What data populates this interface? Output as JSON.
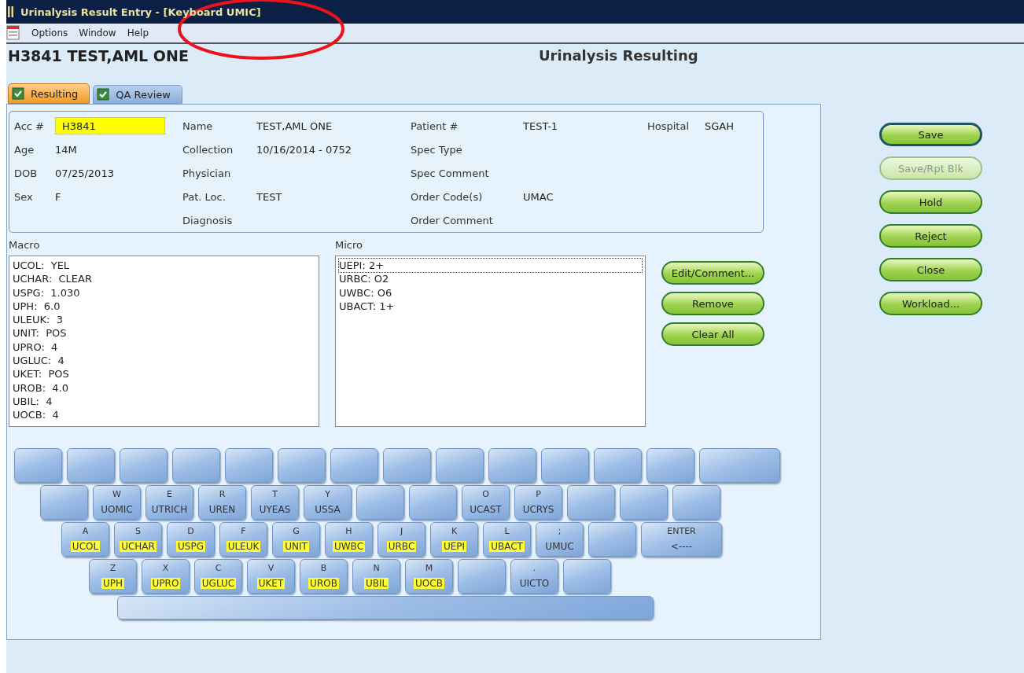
{
  "window": {
    "title": "Urinalysis Result Entry - [Keyboard UMIC]"
  },
  "menu": [
    "Options",
    "Window",
    "Help"
  ],
  "header": {
    "patient": "H3841 TEST,AML ONE",
    "screen_title": "Urinalysis Resulting"
  },
  "tabs": [
    {
      "label": "Resulting",
      "selected": true
    },
    {
      "label": "QA Review",
      "selected": false
    }
  ],
  "info": {
    "rows": [
      [
        {
          "label": "Acc #",
          "value": "H3841",
          "kind": "field"
        },
        {
          "label": "Name",
          "value": "TEST,AML ONE"
        },
        {
          "label": "Patient #",
          "value": "TEST-1"
        },
        {
          "label": "Hospital",
          "value": "SGAH"
        }
      ],
      [
        {
          "label": "Age",
          "value": "14M"
        },
        {
          "label": "Collection",
          "value": "10/16/2014 - 0752"
        },
        {
          "label": "Spec Type"
        },
        null
      ],
      [
        {
          "label": "DOB",
          "value": "07/25/2013"
        },
        {
          "label": "Physician"
        },
        {
          "label": "Spec Comment"
        },
        null
      ],
      [
        {
          "label": "Sex",
          "value": "F"
        },
        {
          "label": "Pat. Loc.",
          "value": "TEST"
        },
        {
          "label": "Order Code(s)",
          "value": "UMAC"
        },
        null
      ],
      [
        null,
        {
          "label": "Diagnosis"
        },
        {
          "label": "Order Comment"
        },
        null
      ]
    ]
  },
  "macro": {
    "label": "Macro",
    "items": [
      "UCOL:  YEL",
      "UCHAR:  CLEAR",
      "USPG:  1.030",
      "UPH:  6.0",
      "ULEUK:  3",
      "UNIT:  POS",
      "UPRO:  4",
      "UGLUC:  4",
      "UKET:  POS",
      "UROB:  4.0",
      "UBIL:  4",
      "UOCB:  4"
    ]
  },
  "micro": {
    "label": "Micro",
    "items": [
      {
        "text": "UEPI: 2+",
        "selected": true
      },
      {
        "text": "URBC: O2",
        "selected": false
      },
      {
        "text": "UWBC: O6",
        "selected": false
      },
      {
        "text": "UBACT: 1+",
        "selected": false
      }
    ]
  },
  "list_buttons": [
    "Edit/Comment...",
    "Remove",
    "Clear All"
  ],
  "keyboard": {
    "rows": [
      [
        {
          "kind": "blank"
        },
        {
          "kind": "blank"
        },
        {
          "kind": "blank"
        },
        {
          "kind": "blank"
        },
        {
          "kind": "blank"
        },
        {
          "kind": "blank"
        },
        {
          "kind": "blank"
        },
        {
          "kind": "blank"
        },
        {
          "kind": "blank"
        },
        {
          "kind": "blank"
        },
        {
          "kind": "blank"
        },
        {
          "kind": "blank"
        },
        {
          "kind": "blank"
        },
        {
          "kind": "wide"
        }
      ],
      [
        {
          "kind": "blank"
        },
        {
          "kind": "key",
          "letter": "W",
          "code": "UOMIC",
          "highlighted": false
        },
        {
          "kind": "key",
          "letter": "E",
          "code": "UTRICH",
          "highlighted": false
        },
        {
          "kind": "key",
          "letter": "R",
          "code": "UREN",
          "highlighted": false
        },
        {
          "kind": "key",
          "letter": "T",
          "code": "UYEAS",
          "highlighted": false
        },
        {
          "kind": "key",
          "letter": "Y",
          "code": "USSA",
          "highlighted": false
        },
        {
          "kind": "blank"
        },
        {
          "kind": "blank"
        },
        {
          "kind": "key",
          "letter": "O",
          "code": "UCAST",
          "highlighted": false
        },
        {
          "kind": "key",
          "letter": "P",
          "code": "UCRYS",
          "highlighted": false
        },
        {
          "kind": "blank"
        },
        {
          "kind": "blank"
        },
        {
          "kind": "blank"
        }
      ],
      [
        {
          "kind": "key",
          "letter": "A",
          "code": "UCOL",
          "highlighted": true
        },
        {
          "kind": "key",
          "letter": "S",
          "code": "UCHAR",
          "highlighted": true
        },
        {
          "kind": "key",
          "letter": "D",
          "code": "USPG",
          "highlighted": true
        },
        {
          "kind": "key",
          "letter": "F",
          "code": "ULEUK",
          "highlighted": true
        },
        {
          "kind": "key",
          "letter": "G",
          "code": "UNIT",
          "highlighted": true
        },
        {
          "kind": "key",
          "letter": "H",
          "code": "UWBC",
          "highlighted": true
        },
        {
          "kind": "key",
          "letter": "J",
          "code": "URBC",
          "highlighted": true
        },
        {
          "kind": "key",
          "letter": "K",
          "code": "UEPI",
          "highlighted": true
        },
        {
          "kind": "key",
          "letter": "L",
          "code": "UBACT",
          "highlighted": true
        },
        {
          "kind": "key",
          "letter": ";",
          "code": "UMUC",
          "highlighted": false
        },
        {
          "kind": "blank"
        },
        {
          "kind": "wide",
          "letter": "ENTER",
          "code": "<----"
        }
      ],
      [
        {
          "kind": "key",
          "letter": "Z",
          "code": "UPH",
          "highlighted": true
        },
        {
          "kind": "key",
          "letter": "X",
          "code": "UPRO",
          "highlighted": true
        },
        {
          "kind": "key",
          "letter": "C",
          "code": "UGLUC",
          "highlighted": true
        },
        {
          "kind": "key",
          "letter": "V",
          "code": "UKET",
          "highlighted": true
        },
        {
          "kind": "key",
          "letter": "B",
          "code": "UROB",
          "highlighted": true
        },
        {
          "kind": "key",
          "letter": "N",
          "code": "UBIL",
          "highlighted": true
        },
        {
          "kind": "key",
          "letter": "M",
          "code": "UOCB",
          "highlighted": true
        },
        {
          "kind": "blank"
        },
        {
          "kind": "key",
          "letter": ".",
          "code": "UICTO",
          "highlighted": false
        },
        {
          "kind": "blank"
        }
      ],
      [
        {
          "kind": "space"
        }
      ]
    ]
  },
  "actions": [
    {
      "label": "Save",
      "disabled": false,
      "default": true
    },
    {
      "label": "Save/Rpt Blk",
      "disabled": true,
      "default": false
    },
    {
      "label": "Hold",
      "disabled": false,
      "default": false
    },
    {
      "label": "Reject",
      "disabled": false,
      "default": false
    },
    {
      "label": "Close",
      "disabled": false,
      "default": false
    },
    {
      "label": "Workload...",
      "disabled": false,
      "default": false
    }
  ]
}
